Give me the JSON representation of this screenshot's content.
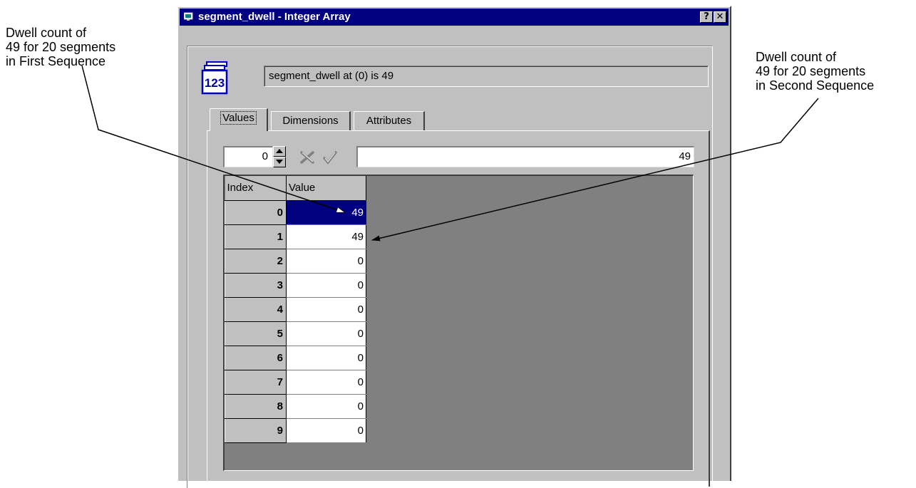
{
  "window": {
    "title": "segment_dwell - Integer Array",
    "help_label": "?",
    "close_label": "✕"
  },
  "icon": {
    "label": "123"
  },
  "status": {
    "text": "segment_dwell at (0) is 49"
  },
  "tabs": [
    {
      "label": "Values",
      "active": true
    },
    {
      "label": "Dimensions",
      "active": false
    },
    {
      "label": "Attributes",
      "active": false
    }
  ],
  "editor": {
    "index_value": "0",
    "value": "49",
    "cancel_icon": "cancel-x-icon",
    "accept_icon": "checkmark-icon"
  },
  "grid": {
    "headers": {
      "index": "Index",
      "value": "Value"
    },
    "rows": [
      {
        "index": "0",
        "value": "49"
      },
      {
        "index": "1",
        "value": "49"
      },
      {
        "index": "2",
        "value": "0"
      },
      {
        "index": "3",
        "value": "0"
      },
      {
        "index": "4",
        "value": "0"
      },
      {
        "index": "5",
        "value": "0"
      },
      {
        "index": "6",
        "value": "0"
      },
      {
        "index": "7",
        "value": "0"
      },
      {
        "index": "8",
        "value": "0"
      },
      {
        "index": "9",
        "value": "0"
      }
    ],
    "selected_row": 0
  },
  "annotations": {
    "left": {
      "lines": [
        "Dwell count of",
        "49 for 20 segments",
        "in First Sequence"
      ]
    },
    "right": {
      "lines": [
        "Dwell count of",
        "49 for 20 segments",
        "in Second Sequence"
      ]
    }
  },
  "colors": {
    "title_bar": "#000080",
    "window_face": "#c0c0c0",
    "selection": "#000080",
    "grid_background": "#808080"
  }
}
